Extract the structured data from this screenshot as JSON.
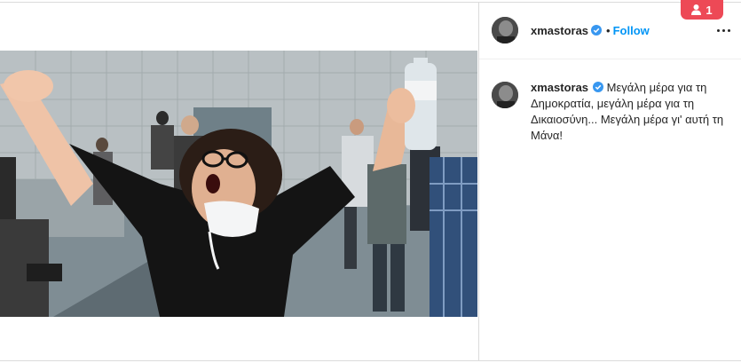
{
  "post": {
    "username": "xmastoras",
    "verified": true,
    "dot": "•",
    "follow_label": "Follow",
    "caption": "Μεγάλη μέρα για τη Δημοκρατία, μεγάλη μέρα για τη Δικαιοσύνη... Μεγάλη μέρα γι' αυτή τη Μάνα!"
  },
  "notification": {
    "count": "1",
    "icon": "person-icon",
    "color": "#ed4956"
  },
  "colors": {
    "link": "#0095f6",
    "verified": "#3897f0",
    "border": "#dbdbdb"
  }
}
